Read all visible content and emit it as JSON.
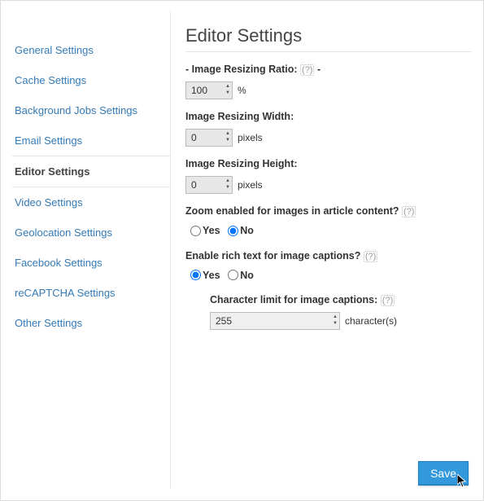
{
  "sidebar": {
    "items": [
      {
        "label": "General Settings",
        "active": false
      },
      {
        "label": "Cache Settings",
        "active": false
      },
      {
        "label": "Background Jobs Settings",
        "active": false
      },
      {
        "label": "Email Settings",
        "active": false
      },
      {
        "label": "Editor Settings",
        "active": true
      },
      {
        "label": "Video Settings",
        "active": false
      },
      {
        "label": "Geolocation Settings",
        "active": false
      },
      {
        "label": "Facebook Settings",
        "active": false
      },
      {
        "label": "reCAPTCHA Settings",
        "active": false
      },
      {
        "label": "Other Settings",
        "active": false
      }
    ]
  },
  "page": {
    "title": "Editor Settings"
  },
  "fields": {
    "ratio": {
      "label": "Image Resizing Ratio:",
      "help": "(?)",
      "value": "100",
      "unit": "%",
      "prefix": "-",
      "suffix": "-"
    },
    "width": {
      "label": "Image Resizing Width:",
      "value": "0",
      "unit": "pixels"
    },
    "height": {
      "label": "Image Resizing Height:",
      "value": "0",
      "unit": "pixels"
    },
    "zoom": {
      "label": "Zoom enabled for images in article content?",
      "help": "(?)",
      "yes": "Yes",
      "no": "No",
      "value": "No"
    },
    "rich": {
      "label": "Enable rich text for image captions?",
      "help": "(?)",
      "yes": "Yes",
      "no": "No",
      "value": "Yes"
    },
    "charlimit": {
      "label": "Character limit for image captions:",
      "help": "(?)",
      "value": "255",
      "unit": "character(s)"
    }
  },
  "buttons": {
    "save": "Save"
  }
}
